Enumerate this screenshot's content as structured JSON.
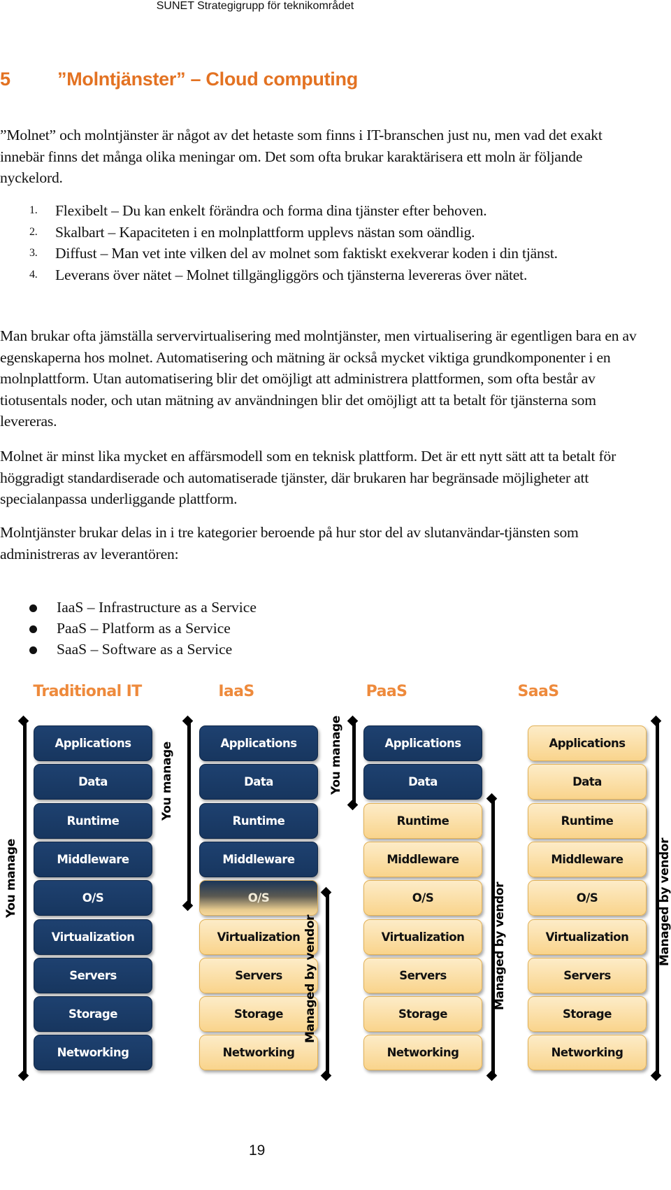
{
  "header": {
    "text": "SUNET Strategigrupp för teknikområdet"
  },
  "heading": {
    "number": "5",
    "title": "”Molntjänster” – Cloud computing",
    "color": "#e37222"
  },
  "paragraphs": {
    "intro": "”Molnet” och molntjänster är något av det hetaste som finns i IT-branschen just nu, men vad det exakt innebär finns det många olika meningar om. Det som ofta brukar karaktärisera ett moln är följande nyckelord.",
    "virtualization": "Man brukar ofta jämställa servervirtualisering med molntjänster, men virtualisering är egentligen bara en av egenskaperna hos molnet. Automatisering och mätning är också mycket viktiga grundkomponenter i en molnplattform. Utan automatisering blir det omöjligt att administrera plattformen, som ofta består av tiotusentals noder, och utan mätning av användningen blir det omöjligt att ta betalt för tjänsterna som levereras.",
    "business": "Molnet är minst lika mycket en affärsmodell som en teknisk plattform. Det är ett nytt sätt att ta betalt för höggradigt standardiserade och automatiserade tjänster, där brukaren har begränsade möjligheter att specialanpassa underliggande plattform.",
    "categories": "Molntjänster brukar delas in i tre kategorier beroende på hur stor del av slutanvändar-tjänsten som administreras av leverantören:"
  },
  "keywords": [
    {
      "n": "1.",
      "text": "Flexibelt – Du kan enkelt förändra och forma dina tjänster efter behoven."
    },
    {
      "n": "2.",
      "text": "Skalbart – Kapaciteten i en molnplattform upplevs nästan som oändlig."
    },
    {
      "n": "3.",
      "text": "Diffust – Man vet inte vilken del av molnet som faktiskt exekverar koden i din tjänst."
    },
    {
      "n": "4.",
      "text": "Leverans över nätet – Molnet tillgängliggörs och tjänsterna levereras över nätet."
    }
  ],
  "service_models": [
    "IaaS – Infrastructure as a Service",
    "PaaS – Platform as a Service",
    "SaaS – Software as a Service"
  ],
  "diagram": {
    "colors": {
      "you_manage": "#17365f",
      "vendor": "#f9d48c",
      "title": "#ee8a3c"
    },
    "layers": [
      "Applications",
      "Data",
      "Runtime",
      "Middleware",
      "O/S",
      "Virtualization",
      "Servers",
      "Storage",
      "Networking"
    ],
    "columns": [
      {
        "title": "Traditional IT",
        "states": [
          "you",
          "you",
          "you",
          "you",
          "you",
          "you",
          "you",
          "you",
          "you"
        ],
        "labels": [
          {
            "text": "You manage",
            "side": "left",
            "range": "Applications–Networking"
          }
        ]
      },
      {
        "title": "IaaS",
        "states": [
          "you",
          "you",
          "you",
          "you",
          "mixed",
          "vendor",
          "vendor",
          "vendor",
          "vendor"
        ],
        "labels": [
          {
            "text": "You manage",
            "side": "left",
            "range": "Applications–O/S"
          },
          {
            "text": "Managed by vendor",
            "side": "right",
            "range": "O/S–Networking"
          }
        ]
      },
      {
        "title": "PaaS",
        "states": [
          "you",
          "you",
          "vendor",
          "vendor",
          "vendor",
          "vendor",
          "vendor",
          "vendor",
          "vendor"
        ],
        "labels": [
          {
            "text": "You manage",
            "side": "left",
            "range": "Applications–Data"
          },
          {
            "text": "Managed by vendor",
            "side": "right",
            "range": "Runtime–Networking"
          }
        ]
      },
      {
        "title": "SaaS",
        "states": [
          "vendor",
          "vendor",
          "vendor",
          "vendor",
          "vendor",
          "vendor",
          "vendor",
          "vendor",
          "vendor"
        ],
        "labels": [
          {
            "text": "Managed by vendor",
            "side": "right",
            "range": "Applications–Networking"
          }
        ]
      }
    ]
  },
  "page_number": "19"
}
